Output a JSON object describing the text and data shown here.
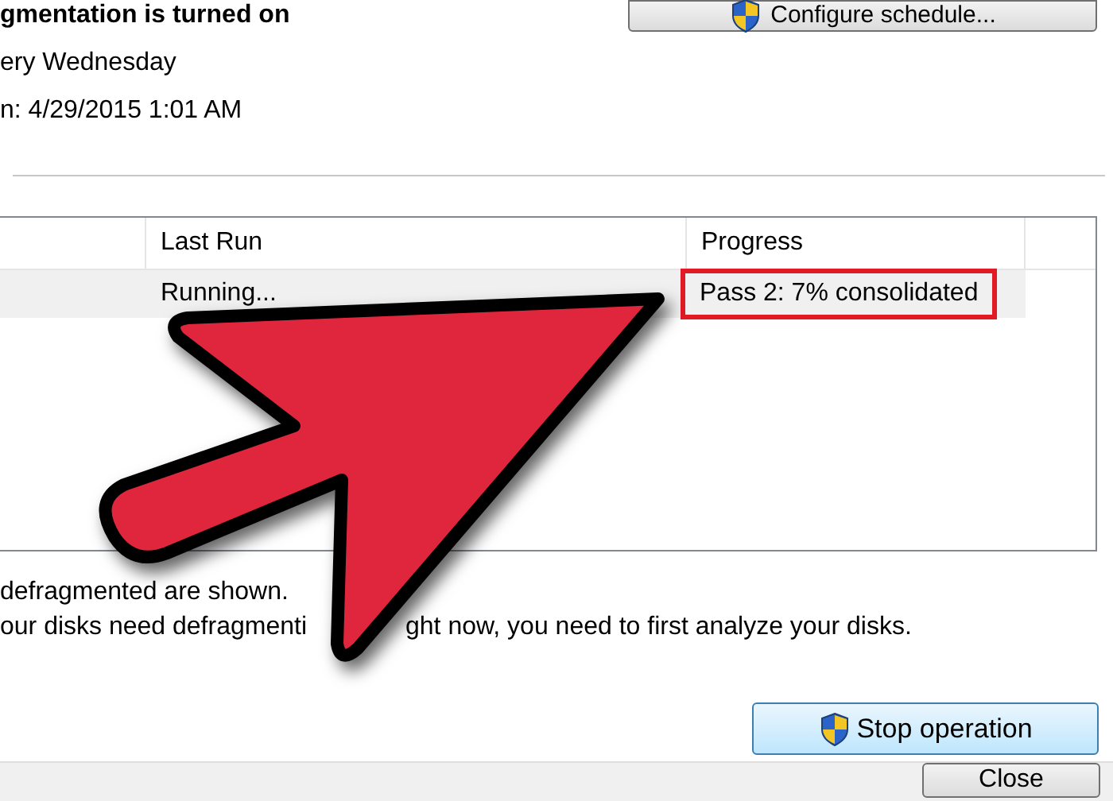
{
  "schedule": {
    "status": "gmentation is turned on",
    "frequency": "ery Wednesday",
    "next_run": "n: 4/29/2015 1:01 AM",
    "button": "Configure schedule..."
  },
  "table": {
    "columns": [
      "Last Run",
      "Progress"
    ],
    "rows": [
      {
        "last_run": "Running...",
        "progress": "Pass 2: 7% consolidated",
        "selected": true,
        "highlighted": true
      }
    ]
  },
  "notes": [
    {
      "parts": [
        "defragmented are shown."
      ]
    },
    {
      "parts": [
        "our disks need defragmenti",
        "ght now, you need to first analyze your disks."
      ]
    }
  ],
  "buttons": {
    "stop": "Stop operation",
    "close": "Close"
  }
}
